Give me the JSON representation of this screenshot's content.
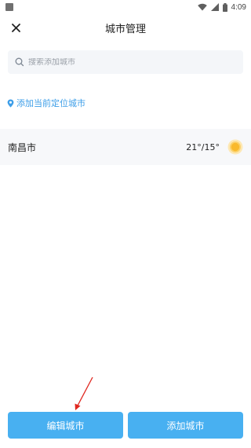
{
  "status_bar": {
    "time": "4:09"
  },
  "header": {
    "title": "城市管理",
    "close_icon": "close-icon"
  },
  "search": {
    "placeholder": "搜索添加城市",
    "icon": "search-icon"
  },
  "locate": {
    "label": "添加当前定位城市",
    "icon": "location-pin-icon",
    "color": "#3d9ee8"
  },
  "cities": [
    {
      "name": "南昌市",
      "temperature": "21°/15°",
      "weather_icon": "sun-icon"
    }
  ],
  "footer": {
    "edit_label": "编辑城市",
    "add_label": "添加城市",
    "button_color": "#48b0f1"
  },
  "annotation": {
    "arrow_color": "#e0271f"
  }
}
